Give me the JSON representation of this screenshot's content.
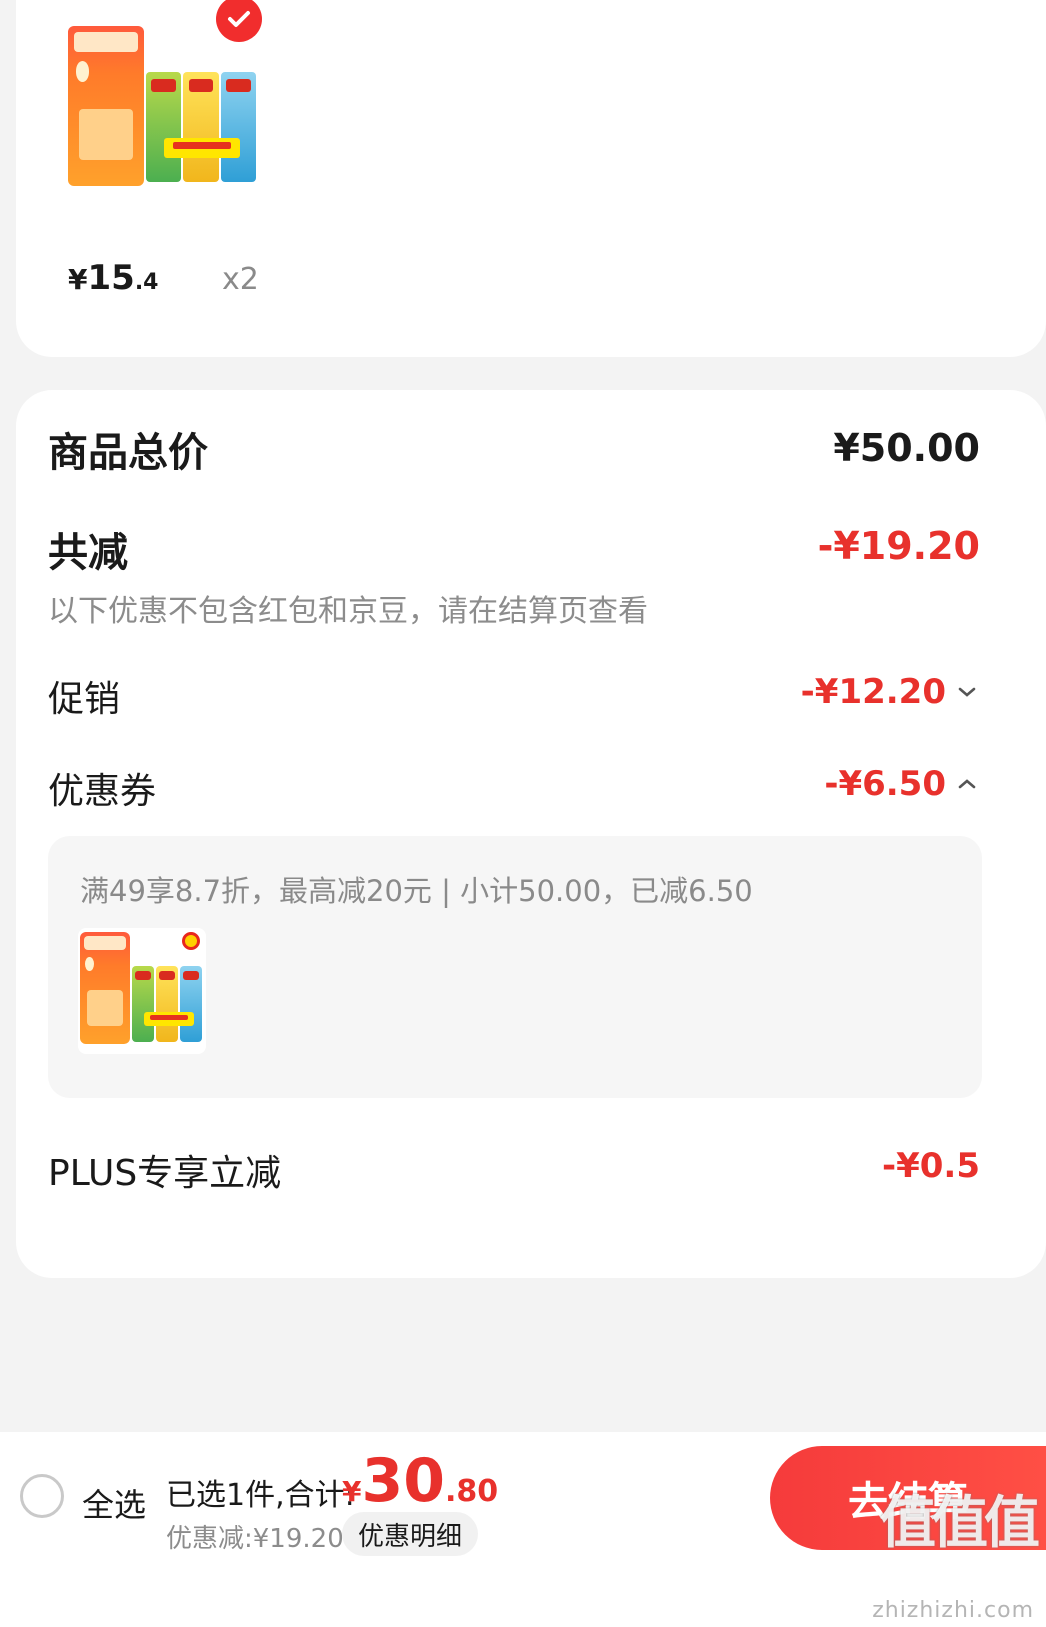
{
  "product": {
    "price_currency": "¥",
    "price_integer": "15",
    "price_decimal": ".4",
    "quantity": "x2"
  },
  "summary": {
    "total_label": "商品总价",
    "total_value": "¥50.00",
    "reduction_label": "共减",
    "reduction_value": "-¥19.20",
    "note": "以下优惠不包含红包和京豆，请在结算页查看",
    "promo_label": "促销",
    "promo_value": "-¥12.20",
    "coupon_label": "优惠券",
    "coupon_value": "-¥6.50",
    "coupon_desc": "满49享8.7折，最高减20元 | 小计50.00，已减6.50",
    "plus_label": "PLUS专享立减",
    "plus_value": "-¥0.5"
  },
  "bottom_bar": {
    "select_all": "全选",
    "sum_label": "已选1件,合计:",
    "sum_currency": "¥",
    "sum_integer": "30",
    "sum_decimal": ".80",
    "discount_line": "优惠减:¥19.20",
    "detail_button": "优惠明细",
    "checkout_button": "去结算"
  },
  "watermark": {
    "text": "值值值",
    "url": "zhizhizhi.com"
  },
  "colors": {
    "accent_red": "#e8312c",
    "checkout_red": "#f53b3b",
    "background": "#f3f3f3"
  }
}
